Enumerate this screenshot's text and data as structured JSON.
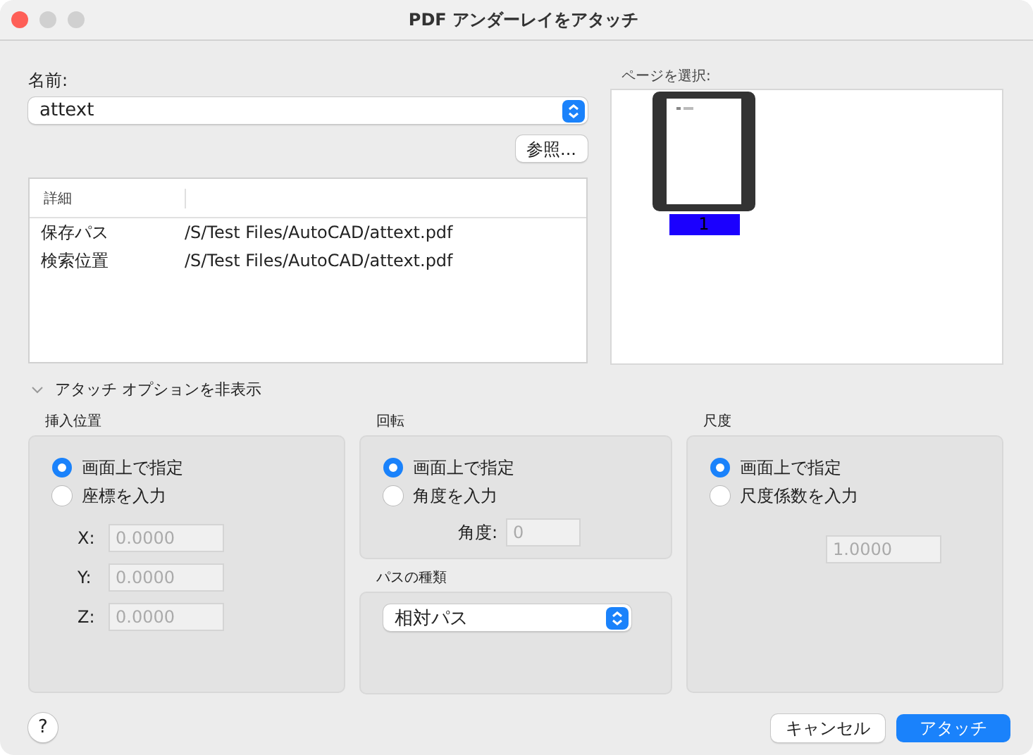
{
  "window": {
    "title": "PDF アンダーレイをアタッチ"
  },
  "name_field": {
    "label": "名前:",
    "value": "attext"
  },
  "browse_button": "参照...",
  "details": {
    "columns": [
      "詳細"
    ],
    "rows": [
      {
        "label": "保存パス",
        "value": "/S/Test Files/AutoCAD/attext.pdf"
      },
      {
        "label": "検索位置",
        "value": "/S/Test Files/AutoCAD/attext.pdf"
      }
    ]
  },
  "page_select": {
    "label": "ページを選択:",
    "pages": [
      {
        "number": "1",
        "selected": true
      }
    ]
  },
  "options_toggle": {
    "label": "アタッチ オプションを非表示",
    "expanded": true
  },
  "insertion": {
    "title": "挿入位置",
    "options": [
      {
        "label": "画面上で指定",
        "selected": true
      },
      {
        "label": "座標を入力",
        "selected": false
      }
    ],
    "fields": [
      {
        "label": "X:",
        "value": "0.0000",
        "disabled": true
      },
      {
        "label": "Y:",
        "value": "0.0000",
        "disabled": true
      },
      {
        "label": "Z:",
        "value": "0.0000",
        "disabled": true
      }
    ]
  },
  "rotation": {
    "title": "回転",
    "options": [
      {
        "label": "画面上で指定",
        "selected": true
      },
      {
        "label": "角度を入力",
        "selected": false
      }
    ],
    "angle": {
      "label": "角度:",
      "value": "0",
      "disabled": true
    }
  },
  "path_type": {
    "title": "パスの種類",
    "value": "相対パス"
  },
  "scale": {
    "title": "尺度",
    "options": [
      {
        "label": "画面上で指定",
        "selected": true
      },
      {
        "label": "尺度係数を入力",
        "selected": false
      }
    ],
    "factor": {
      "value": "1.0000",
      "disabled": true
    }
  },
  "help": "?",
  "buttons": [
    {
      "label": "キャンセル",
      "kind": "secondary"
    },
    {
      "label": "アタッチ",
      "kind": "primary"
    }
  ]
}
